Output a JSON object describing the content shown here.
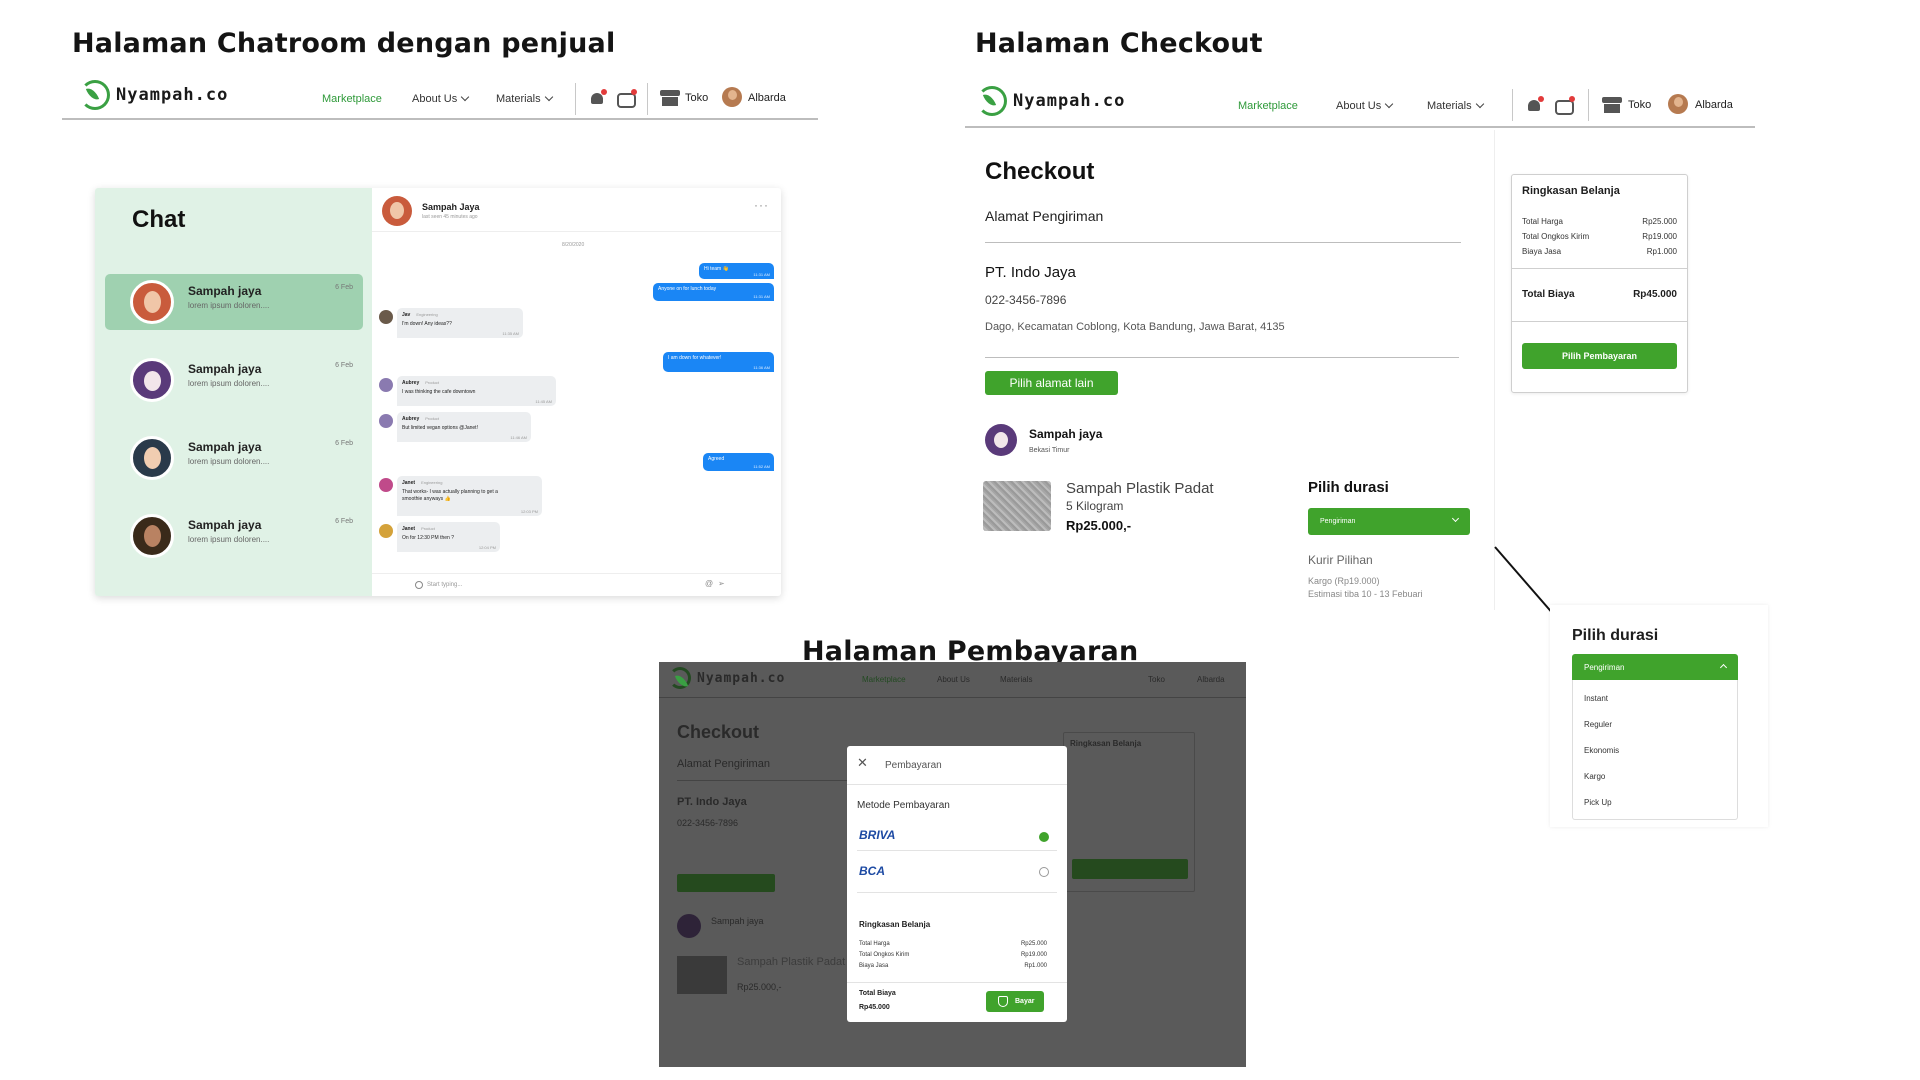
{
  "headings": {
    "chatroom": "Halaman Chatroom dengan penjual",
    "checkout": "Halaman Checkout",
    "pembayaran": "Halaman Pembayaran"
  },
  "nav": {
    "logo": "Nyampah.co",
    "marketplace": "Marketplace",
    "about": "About Us",
    "materials": "Materials",
    "store": "Toko",
    "user": "Albarda"
  },
  "chat": {
    "title": "Chat",
    "conversations": [
      {
        "name": "Sampah jaya",
        "preview": "lorem ipsum doloren....",
        "date": "6 Feb"
      },
      {
        "name": "Sampah jaya",
        "preview": "lorem ipsum doloren....",
        "date": "6 Feb"
      },
      {
        "name": "Sampah jaya",
        "preview": "lorem ipsum doloren....",
        "date": "6 Feb"
      },
      {
        "name": "Sampah jaya",
        "preview": "lorem ipsum doloren....",
        "date": "6 Feb"
      }
    ],
    "header": {
      "name": "Sampah Jaya",
      "seen": "last seen 45 minutes ago",
      "more": "···"
    },
    "date_divider": "8/20/2020",
    "messages": [
      {
        "dir": "out",
        "text": "Hi team 👋",
        "time": "11:31 AM"
      },
      {
        "dir": "out",
        "text": "Anyone on for lunch today",
        "time": "11:31 AM"
      },
      {
        "dir": "in",
        "who": "Jav",
        "role": "Engineering",
        "text": "I'm down! Any ideas??",
        "time": "11:35 AM"
      },
      {
        "dir": "out",
        "text": "I am down for whatever!",
        "time": "11:36 AM"
      },
      {
        "dir": "in",
        "who": "Aubrey",
        "role": "Product",
        "text": "I was thinking the cafe downtown",
        "time": "11:45 AM"
      },
      {
        "dir": "in",
        "who": "Aubrey",
        "role": "Product",
        "text": "But limited vegan options @Janet!",
        "time": "11:46 AM"
      },
      {
        "dir": "out",
        "text": "Agreed",
        "time": "11:52 AM"
      },
      {
        "dir": "in",
        "who": "Janet",
        "role": "Engineering",
        "text": "That works- I was actually planning to get a smoothie anyways 👍",
        "time": "12:03 PM"
      },
      {
        "dir": "in",
        "who": "Janet",
        "role": "Product",
        "text": "On for 12:30 PM then ?",
        "time": "12:04 PM"
      }
    ],
    "input_placeholder": "Start typing...",
    "at": "@",
    "send": "➢"
  },
  "checkout": {
    "title": "Checkout",
    "address_label": "Alamat Pengiriman",
    "company": "PT. Indo Jaya",
    "phone": "022-3456-7896",
    "address": "Dago, Kecamatan Coblong, Kota Bandung, Jawa Barat, 4135",
    "other_address_btn": "Pilih alamat lain",
    "seller": "Sampah jaya",
    "seller_location": "Bekasi Timur",
    "product_name": "Sampah Plastik Padat",
    "product_qty": "5 Kilogram",
    "product_price": "Rp25.000,-",
    "duration_title": "Pilih durasi",
    "shipping_dropdown": "Pengiriman",
    "courier_title": "Kurir Pilihan",
    "courier_info": "Kargo (Rp19.000)",
    "courier_eta": "Estimasi tiba 10 - 13 Febuari"
  },
  "summary": {
    "title": "Ringkasan Belanja",
    "rows": [
      {
        "label": "Total Harga",
        "value": "Rp25.000"
      },
      {
        "label": "Total Ongkos Kirim",
        "value": "Rp19.000"
      },
      {
        "label": "Biaya Jasa",
        "value": "Rp1.000"
      }
    ],
    "total_label": "Total Biaya",
    "total_value": "Rp45.000",
    "pay_btn": "Pilih Pembayaran"
  },
  "duration_zoom": {
    "title": "Pilih durasi",
    "dropdown": "Pengiriman",
    "options": [
      "Instant",
      "Reguler",
      "Ekonomis",
      "Kargo",
      "Pick Up"
    ]
  },
  "payment_modal": {
    "close": "✕",
    "title": "Pembayaran",
    "method_label": "Metode Pembayaran",
    "banks": [
      {
        "name": "BRIVA",
        "selected": true
      },
      {
        "name": "BCA",
        "selected": false
      }
    ],
    "summary_title": "Ringkasan Belanja",
    "rows": [
      {
        "label": "Total Harga",
        "value": "Rp25.000"
      },
      {
        "label": "Total Ongkos Kirim",
        "value": "Rp19.000"
      },
      {
        "label": "Biaya Jasa",
        "value": "Rp1.000"
      }
    ],
    "total_label": "Total Biaya",
    "total_value": "Rp45.000",
    "pay_btn": "Bayar"
  },
  "colors": {
    "brand_green": "#40a32c",
    "chat_bg": "#e0f2e6",
    "chat_active": "#9fd1b0",
    "bubble_out": "#1a86f5"
  }
}
